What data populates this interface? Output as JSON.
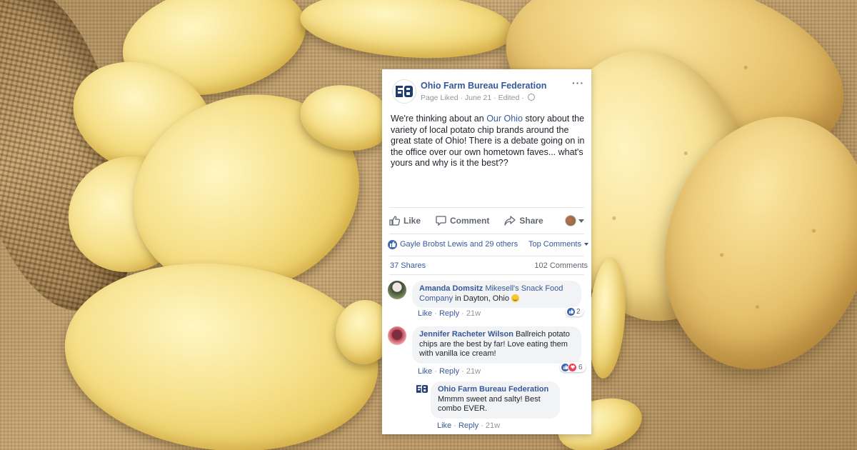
{
  "post": {
    "page_name": "Ohio Farm Bureau Federation",
    "meta": "Page Liked · June 21 · Edited · ",
    "text_before_link": "We're thinking about an ",
    "text_link": "Our Ohio",
    "text_after_link": " story about the variety of local potato chip brands around the great state of Ohio! There is a debate going on in the office over our own hometown faves... what's yours and why is it the best??",
    "more_icon": "more-dots-icon",
    "logo_text": "FB"
  },
  "actions": {
    "like": "Like",
    "comment": "Comment",
    "share": "Share"
  },
  "stats": {
    "likes": "Gayle Brobst Lewis and 29 others",
    "sort": "Top Comments",
    "shares": "37 Shares",
    "comments": "102 Comments"
  },
  "comments": [
    {
      "author": "Amanda Domsitz",
      "tag": "Mikesell's Snack Food Company",
      "text": " in Dayton, Ohio ",
      "like": "Like",
      "reply": "Reply",
      "time": "21w",
      "reactions": "2"
    },
    {
      "author": "Jennifer Racheter Wilson",
      "text": " Ballreich potato chips are the best by far! Love eating them with vanilla ice cream!",
      "like": "Like",
      "reply": "Reply",
      "time": "21w",
      "reactions": "6"
    }
  ],
  "reply": {
    "author": "Ohio Farm Bureau Federation",
    "text": "Mmmm sweet and salty! Best combo EVER.",
    "like": "Like",
    "reply": "Reply",
    "time": "21w"
  },
  "colors": {
    "facebook_blue": "#365899",
    "like_blue": "#4267b2",
    "love_red": "#f33e58"
  }
}
